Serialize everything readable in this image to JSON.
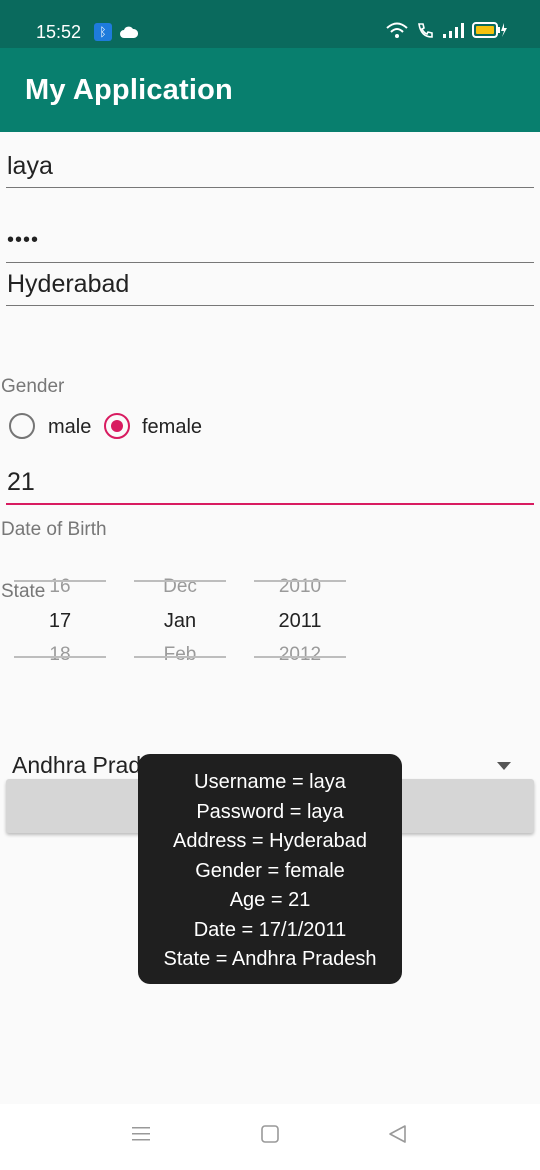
{
  "status_bar": {
    "time": "15:52",
    "icons": [
      "bluetooth-icon",
      "cloud-icon",
      "wifi-icon",
      "call-icon",
      "signal-icon",
      "battery-icon"
    ]
  },
  "app_bar": {
    "title": "My Application"
  },
  "form": {
    "username": "laya",
    "password_mask": "••••",
    "address": "Hyderabad",
    "gender_label": "Gender",
    "gender_options": [
      {
        "label": "male",
        "checked": false
      },
      {
        "label": "female",
        "checked": true
      }
    ],
    "age": "21",
    "dob_label": "Date of Birth",
    "state_label": "State",
    "date_picker": {
      "day": {
        "prev": "16",
        "selected": "17",
        "next": "18"
      },
      "month": {
        "prev": "Dec",
        "selected": "Jan",
        "next": "Feb"
      },
      "year": {
        "prev": "2010",
        "selected": "2011",
        "next": "2012"
      }
    },
    "state_value": "Andhra Pradesh"
  },
  "toast": {
    "lines": [
      "Username = laya",
      "Password = laya",
      "Address = Hyderabad",
      "Gender = female",
      "Age = 21",
      "Date = 17/1/2011",
      "State = Andhra Pradesh"
    ]
  },
  "colors": {
    "app_bar": "#087f6e",
    "status_bar": "#0a6a5d",
    "accent": "#d81b60"
  },
  "nav_bar": {
    "icons": [
      "menu-icon",
      "home-icon",
      "back-icon"
    ]
  }
}
